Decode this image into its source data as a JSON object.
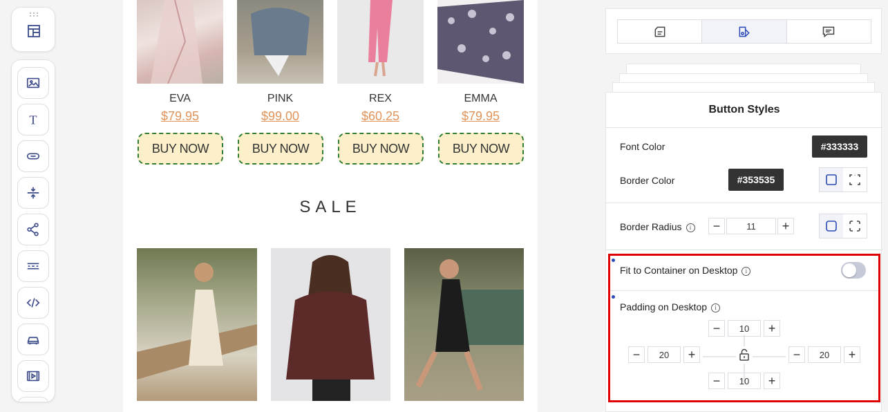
{
  "toolbar": {
    "top_icon": "layout-icon",
    "items": [
      {
        "icon": "image-icon"
      },
      {
        "icon": "text-icon",
        "glyph": "T"
      },
      {
        "icon": "button-icon"
      },
      {
        "icon": "spacer-icon"
      },
      {
        "icon": "share-icon"
      },
      {
        "icon": "divider-icon"
      },
      {
        "icon": "code-icon",
        "glyph": "</>"
      },
      {
        "icon": "product-icon"
      },
      {
        "icon": "video-icon"
      }
    ]
  },
  "canvas": {
    "products": [
      {
        "name": "EVA",
        "price": "$79.95",
        "button": "BUY NOW"
      },
      {
        "name": "PINK",
        "price": "$99.00",
        "button": "BUY NOW"
      },
      {
        "name": "REX",
        "price": "$60.25",
        "button": "BUY NOW"
      },
      {
        "name": "EMMA",
        "price": "$79.95",
        "button": "BUY NOW"
      }
    ],
    "sale_heading": "SALE"
  },
  "panel": {
    "tabs": [
      {
        "icon": "content-icon",
        "active": false
      },
      {
        "icon": "style-icon",
        "active": true
      },
      {
        "icon": "comment-icon",
        "active": false
      }
    ],
    "title": "Button Styles",
    "font_color_label": "Font Color",
    "font_color_value": "#333333",
    "border_color_label": "Border Color",
    "border_color_value": "#353535",
    "border_radius_label": "Border Radius",
    "border_radius_value": "11",
    "fit_label": "Fit to Container on Desktop",
    "fit_enabled": false,
    "padding_label": "Padding on Desktop",
    "padding": {
      "top": "10",
      "left": "20",
      "right": "20",
      "bottom": "10"
    },
    "accent_color": "#2b4bb6",
    "highlight_color": "#e00000"
  }
}
